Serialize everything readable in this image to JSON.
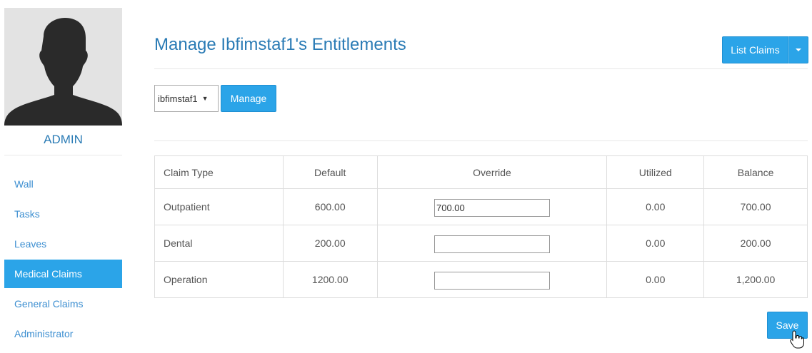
{
  "sidebar": {
    "username": "ADMIN",
    "items": [
      {
        "label": "Wall"
      },
      {
        "label": "Tasks"
      },
      {
        "label": "Leaves"
      },
      {
        "label": "Medical Claims",
        "active": true
      },
      {
        "label": "General Claims"
      },
      {
        "label": "Administrator"
      }
    ]
  },
  "header": {
    "title": "Manage Ibfimstaf1's Entitlements",
    "list_claims_label": "List Claims"
  },
  "filter": {
    "selected_staff": "ibfimstaf1",
    "manage_label": "Manage"
  },
  "table": {
    "headers": [
      "Claim Type",
      "Default",
      "Override",
      "Utilized",
      "Balance"
    ],
    "rows": [
      {
        "type": "Outpatient",
        "default": "600.00",
        "override": "700.00",
        "utilized": "0.00",
        "balance": "700.00"
      },
      {
        "type": "Dental",
        "default": "200.00",
        "override": "",
        "utilized": "0.00",
        "balance": "200.00"
      },
      {
        "type": "Operation",
        "default": "1200.00",
        "override": "",
        "utilized": "0.00",
        "balance": "1,200.00"
      }
    ]
  },
  "actions": {
    "save_label": "Save"
  },
  "colors": {
    "accent": "#2ba4e8",
    "title": "#2a7bb5",
    "link": "#3d8fd1"
  },
  "icons": {
    "avatar": "person-silhouette-icon",
    "dropdown": "chevron-down-icon",
    "cursor": "hand-pointer-icon"
  }
}
